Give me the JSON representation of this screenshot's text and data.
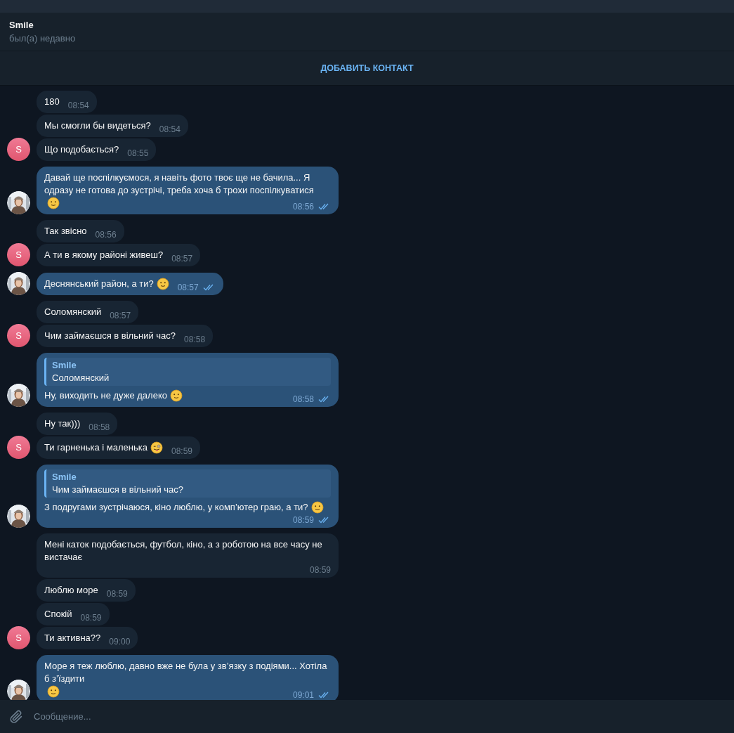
{
  "header": {
    "name": "Smile",
    "status": "был(а) недавно"
  },
  "add_contact": {
    "label": "ДОБАВИТЬ КОНТАКТ"
  },
  "groups": [
    {
      "kind": "incoming",
      "avatar": {
        "kind": "letter",
        "text": "S"
      },
      "messages": [
        {
          "text": "180",
          "time": "08:54"
        },
        {
          "text": "Мы смогли бы видеться?",
          "time": "08:54"
        },
        {
          "text": "Що подобається?",
          "time": "08:55"
        }
      ]
    },
    {
      "kind": "outgoing",
      "avatar": {
        "kind": "picture"
      },
      "messages": [
        {
          "text": "Давай ще поспілкуємося, я навіть фото твоє ще не бачила... Я одразу не готова до зустрічі, треба хоча б трохи поспілкуватися",
          "emoji": {
            "kind": "smile"
          },
          "time": "08:56",
          "read": true
        }
      ]
    },
    {
      "kind": "incoming",
      "avatar": {
        "kind": "letter",
        "text": "S"
      },
      "messages": [
        {
          "text": "Так звісно",
          "time": "08:56"
        },
        {
          "text": "А ти в якому районі живеш?",
          "time": "08:57"
        }
      ]
    },
    {
      "kind": "outgoing",
      "avatar": {
        "kind": "picture"
      },
      "messages": [
        {
          "text": "Деснянський район, а ти?",
          "emoji": {
            "kind": "smile"
          },
          "time": "08:57",
          "read": true
        }
      ]
    },
    {
      "kind": "incoming",
      "avatar": {
        "kind": "letter",
        "text": "S"
      },
      "messages": [
        {
          "text": "Соломянский",
          "time": "08:57"
        },
        {
          "text": "Чим займаєшся в вільний час?",
          "time": "08:58"
        }
      ]
    },
    {
      "kind": "outgoing",
      "avatar": {
        "kind": "picture"
      },
      "messages": [
        {
          "reply": {
            "name": "Smile",
            "text": "Соломянский"
          },
          "text": "Ну, виходить не дуже далеко",
          "emoji": {
            "kind": "smile"
          },
          "time": "08:58",
          "read": true
        }
      ]
    },
    {
      "kind": "incoming",
      "avatar": {
        "kind": "letter",
        "text": "S"
      },
      "messages": [
        {
          "text": "Ну так)))",
          "time": "08:58"
        },
        {
          "text": "Ти гарненька і маленька",
          "emoji": {
            "kind": "wink"
          },
          "time": "08:59"
        }
      ]
    },
    {
      "kind": "outgoing",
      "avatar": {
        "kind": "picture"
      },
      "messages": [
        {
          "reply": {
            "name": "Smile",
            "text": "Чим займаєшся в вільний час?"
          },
          "text": "З подругами зустрічаюся, кіно люблю, у комп’ютер граю, а ти?",
          "emoji": {
            "kind": "smile"
          },
          "time": "08:59",
          "read": true
        }
      ]
    },
    {
      "kind": "incoming",
      "avatar": {
        "kind": "letter",
        "text": "S"
      },
      "messages": [
        {
          "text": "Мені каток подобається, футбол, кіно, а з роботою на все часу не вистачає",
          "time": "08:59"
        },
        {
          "text": "Люблю море",
          "time": "08:59"
        },
        {
          "text": "Спокій",
          "time": "08:59"
        },
        {
          "text": "Ти активна??",
          "time": "09:00"
        }
      ]
    },
    {
      "kind": "outgoing",
      "avatar": {
        "kind": "picture"
      },
      "messages": [
        {
          "text": "Море я теж люблю, давно вже не була у зв’язку з подіями... Хотіла б з’їздити",
          "emoji": {
            "kind": "smile"
          },
          "time": "09:01",
          "read": true
        }
      ]
    }
  ],
  "composer": {
    "placeholder": "Сообщение..."
  }
}
